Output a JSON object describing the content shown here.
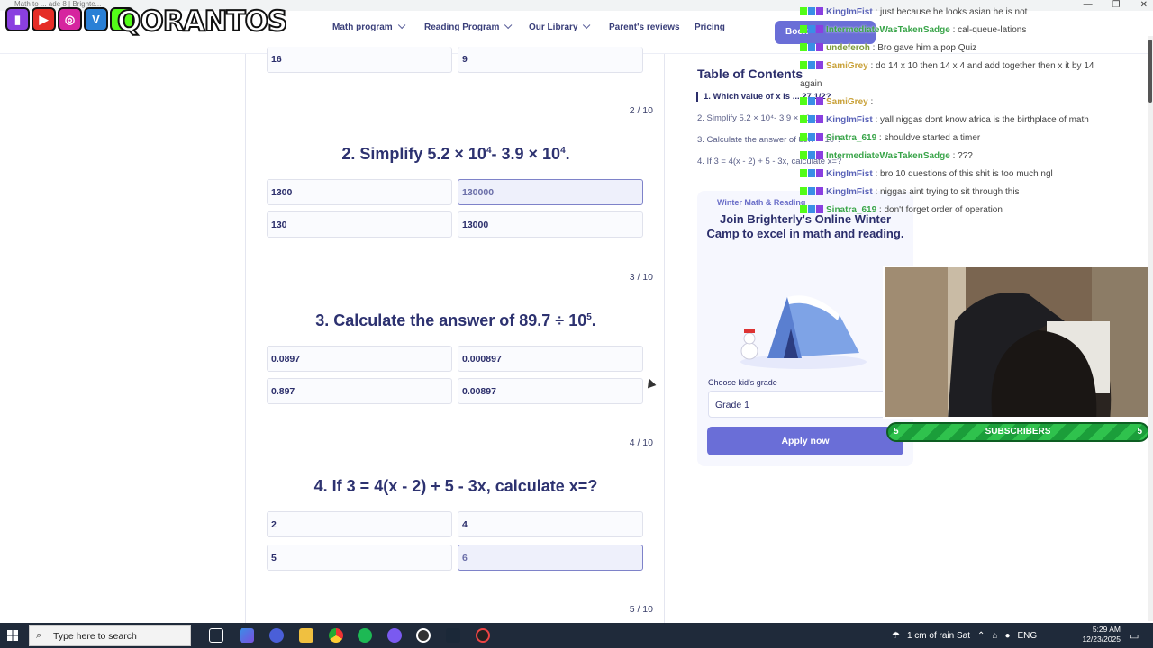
{
  "browser": {
    "tab_title": "Math to ... ade 8 | Brighte..."
  },
  "overlay": {
    "brand": "QORANTOS",
    "socials": [
      "twitch-icon",
      "youtube-icon",
      "instagram-icon",
      "vk-icon",
      "kick-icon"
    ]
  },
  "nav": {
    "items": [
      "Math program",
      "Reading Program",
      "Our Library",
      "Parent's reviews",
      "Pricing"
    ],
    "book_label": "Book"
  },
  "quiz": {
    "top_options": [
      "16",
      "9"
    ],
    "questions": [
      {
        "number": "2 / 10",
        "title_parts": [
          "2. Simplify 5.2 × 10",
          "4",
          "- 3.9 × 10",
          "4",
          "."
        ],
        "options": [
          "1300",
          "130000",
          "130",
          "13000"
        ],
        "selected": 1
      },
      {
        "number": "3 / 10",
        "title_parts": [
          "3. Calculate the answer of 89.7 ÷ 10",
          "5",
          "."
        ],
        "options": [
          "0.0897",
          "0.000897",
          "0.897",
          "0.00897"
        ],
        "selected": -1
      },
      {
        "number": "4 / 10",
        "title_parts": [
          "4. If 3 = 4(x - 2) + 5 - 3x, calculate x=?"
        ],
        "options": [
          "2",
          "4",
          "5",
          "6"
        ],
        "selected": 3
      }
    ],
    "next_number": "5 / 10"
  },
  "toc": {
    "title": "Table of Contents",
    "items": [
      "1. Which value of x is ... 27 1/2?",
      "2. Simplify 5.2 × 10⁴- 3.9 × 10⁴.",
      "3. Calculate the answer of 89.7 ÷ 10⁵.",
      "4. If 3 = 4(x - 2) + 5 - 3x, calculate x=?"
    ]
  },
  "promo": {
    "eyebrow": "Winter Math & Reading",
    "headline": "Join Brighterly's Online Winter Camp to excel in math and reading.",
    "grade_label": "Choose kid's grade",
    "grade_value": "Grade 1",
    "apply_label": "Apply now"
  },
  "chat": [
    {
      "user": "KingImFist",
      "color": "#5a63b8",
      "msg": ": just because he looks asian he is not"
    },
    {
      "user": "IntermediateWasTakenSadge",
      "color": "#3aa54a",
      "msg": ": cal-queue-lations"
    },
    {
      "user": "undeferoh",
      "color": "#7d9a3a",
      "msg": ": Bro gave him a pop Quiz"
    },
    {
      "user": "SamiGrey",
      "color": "#c9a23a",
      "msg": ": do 14 x 10 then 14 x 4 and add together then x it by 14"
    },
    {
      "user": "",
      "color": "#444",
      "msg": "again"
    },
    {
      "user": "SamiGrey",
      "color": "#c9a23a",
      "msg": ":"
    },
    {
      "user": "KingImFist",
      "color": "#5a63b8",
      "msg": ": yall niggas dont know africa is the birthplace of math"
    },
    {
      "user": "Sinatra_619",
      "color": "#3aa54a",
      "msg": ": shouldve started a timer"
    },
    {
      "user": "IntermediateWasTakenSadge",
      "color": "#3aa54a",
      "msg": ": ???"
    },
    {
      "user": "KingImFist",
      "color": "#5a63b8",
      "msg": ": bro 10 questions of this shit is too much ngl"
    },
    {
      "user": "KingImFist",
      "color": "#5a63b8",
      "msg": ": niggas aint trying to sit through this"
    },
    {
      "user": "Sinatra_619",
      "color": "#3aa54a",
      "msg": ": don't forget order of operation"
    }
  ],
  "subscribers": {
    "label": "SUBSCRIBERS",
    "left": "5",
    "right": "5"
  },
  "taskbar": {
    "search_placeholder": "Type here to search",
    "weather": "1 cm of rain Sat",
    "lang": "ENG",
    "time": "5:29 AM",
    "date": "12/23/2025"
  }
}
